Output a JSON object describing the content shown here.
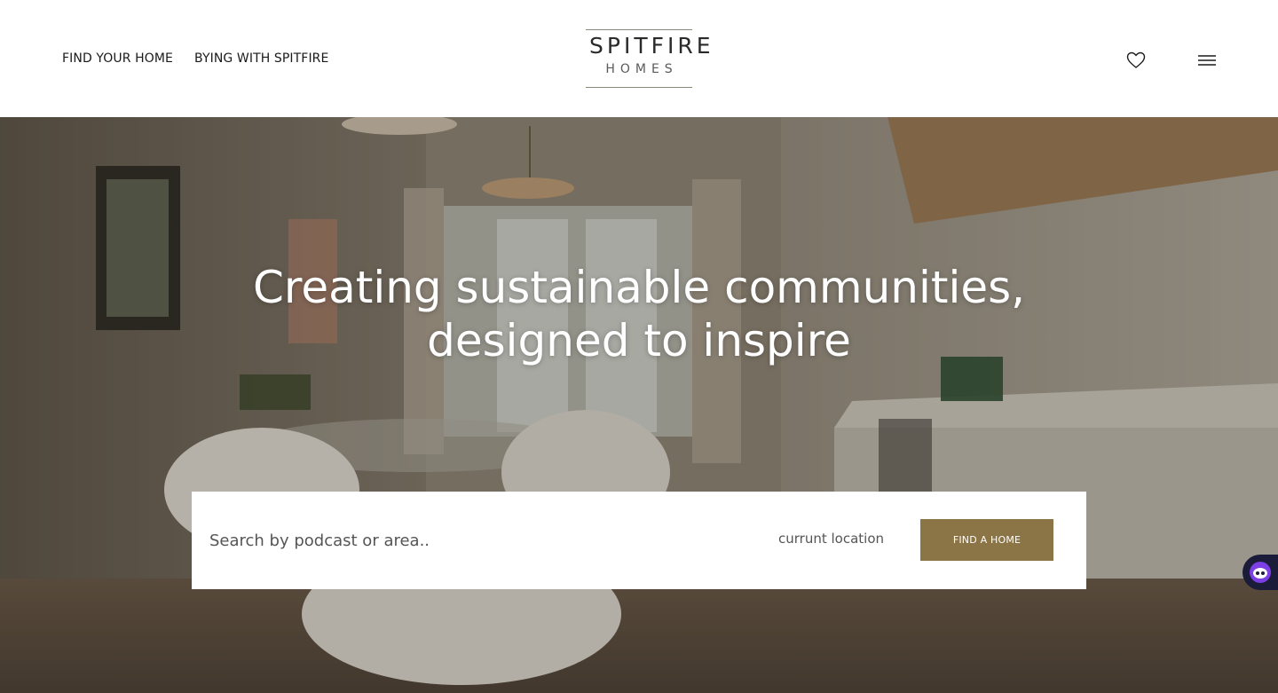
{
  "header": {
    "nav": [
      {
        "label": "FIND YOUR HOME"
      },
      {
        "label": "BYING WITH SPITFIRE"
      }
    ],
    "logo": {
      "main": "SPITFIRE",
      "sub": "HOMES"
    },
    "icons": {
      "favourites": "heart-icon",
      "menu": "hamburger-menu-icon"
    }
  },
  "hero": {
    "title_line1": "Creating sustainable communities,",
    "title_line2": "designed to inspire"
  },
  "search": {
    "placeholder": "Search by podcast or area..",
    "location_label": "currunt location",
    "button_label": "FIND A HOME"
  },
  "colors": {
    "accent": "#8b7446",
    "text_dark": "#1a1a1a",
    "chat_widget": "#7b3fe4"
  }
}
